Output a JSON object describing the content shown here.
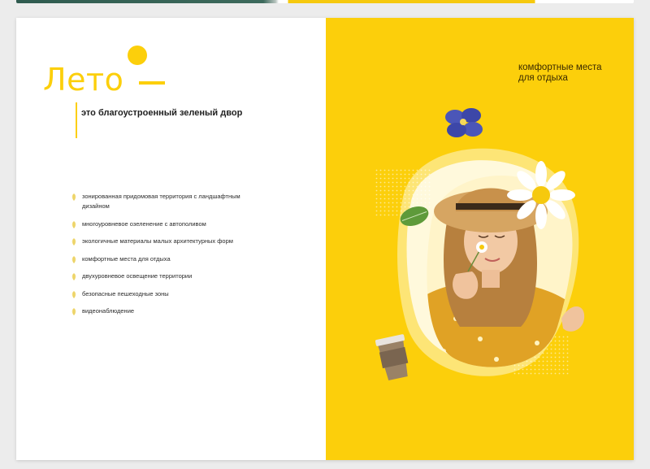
{
  "left_page": {
    "title": "Лето",
    "subtitle": "это благоустроенный зеленый двор",
    "features": [
      "зонированная придомовая территория с ландшафтным дизайном",
      "многоуровневое озеленение с автополивом",
      "экологичные материалы малых архитектурных форм",
      "комфортные места для отдыха",
      "двухуровневое освещение территории",
      "безопасные пешеходные зоны",
      "видеонаблюдение"
    ]
  },
  "right_page": {
    "caption": "комфортные места для отдыха"
  },
  "colors": {
    "accent_yellow": "#fccf0b",
    "text_dark": "#1f1f1f"
  },
  "icons": {
    "bullet": "leaf-icon",
    "decor": [
      "sun-dot-icon",
      "blue-flower-icon",
      "daisy-icon",
      "green-leaf-icon",
      "coffee-cup-icon"
    ]
  }
}
